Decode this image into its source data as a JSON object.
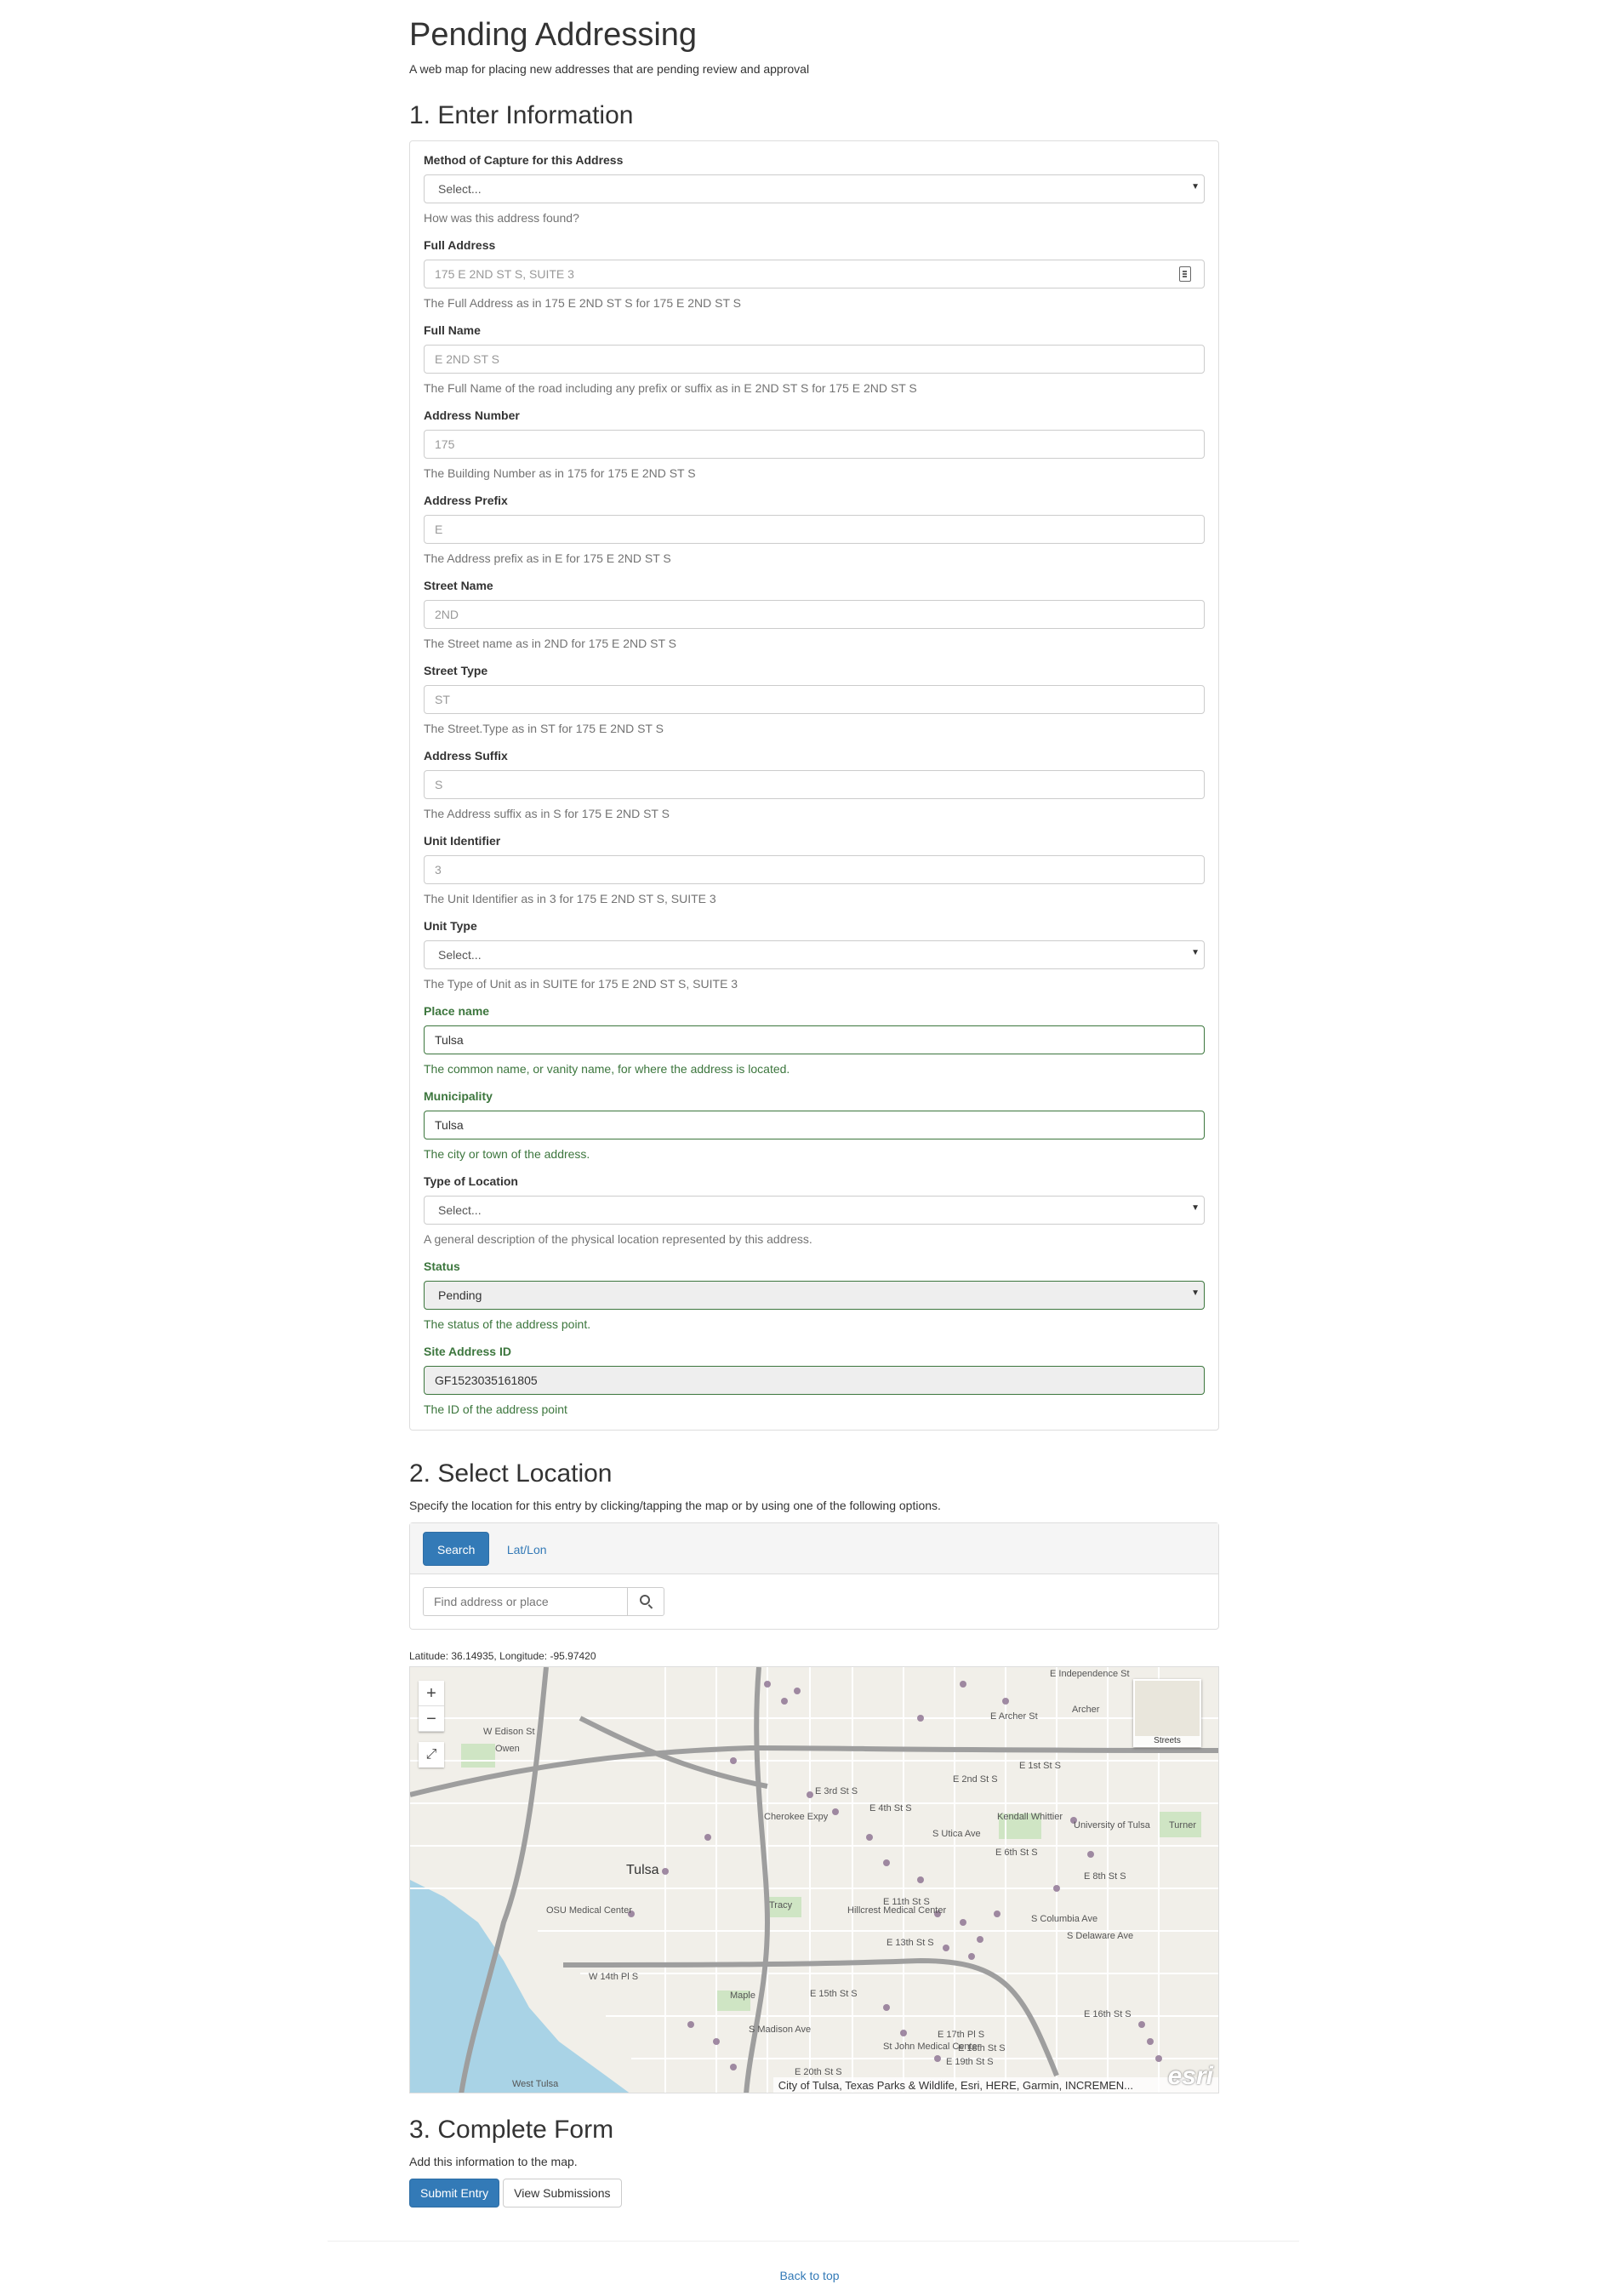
{
  "header": {
    "title": "Pending Addressing",
    "subtitle": "A web map for placing new addresses that are pending review and approval"
  },
  "section1": {
    "title": "1. Enter Information",
    "fields": [
      {
        "label": "Method of Capture for this Address",
        "type": "select",
        "value": "Select...",
        "help": "How was this address found?"
      },
      {
        "label": "Full Address",
        "type": "input",
        "placeholder": "175 E 2ND ST S, SUITE 3",
        "help": "The Full Address as in 175 E 2ND ST S for 175 E 2ND ST S"
      },
      {
        "label": "Full Name",
        "type": "input",
        "placeholder": "E 2ND ST S",
        "help": "The Full Name of the road including any prefix or suffix as in E 2ND ST S for 175 E 2ND ST S"
      },
      {
        "label": "Address Number",
        "type": "input",
        "placeholder": "175",
        "help": "The Building Number as in 175 for 175 E 2ND ST S"
      },
      {
        "label": "Address Prefix",
        "type": "input",
        "placeholder": "E",
        "help": "The Address prefix as in E for 175 E 2ND ST S"
      },
      {
        "label": "Street Name",
        "type": "input",
        "placeholder": "2ND",
        "help": "The Street name as in 2ND for 175 E 2ND ST S"
      },
      {
        "label": "Street Type",
        "type": "input",
        "placeholder": "ST",
        "help": "The Street.Type as in ST for 175 E 2ND ST S"
      },
      {
        "label": "Address Suffix",
        "type": "input",
        "placeholder": "S",
        "help": "The Address suffix as in S for 175 E 2ND ST S"
      },
      {
        "label": "Unit Identifier",
        "type": "input",
        "placeholder": "3",
        "help": "The Unit Identifier as in 3 for 175 E 2ND ST S, SUITE 3"
      },
      {
        "label": "Unit Type",
        "type": "select",
        "value": "Select...",
        "help": "The Type of Unit as in SUITE for 175 E 2ND ST S, SUITE 3"
      },
      {
        "label": "Place name",
        "type": "input",
        "value": "Tulsa",
        "help": "The common name, or vanity name, for where the address is located."
      },
      {
        "label": "Municipality",
        "type": "input",
        "value": "Tulsa",
        "help": "The city or town of the address."
      },
      {
        "label": "Type of Location",
        "type": "select",
        "value": "Select...",
        "help": "A general description of the physical location represented by this address."
      },
      {
        "label": "Status",
        "type": "select",
        "value": "Pending",
        "help": "The status of the address point."
      },
      {
        "label": "Site Address ID",
        "type": "input",
        "value": "GF1523035161805",
        "help": "The ID of the address point"
      }
    ]
  },
  "section2": {
    "title": "2. Select Location",
    "description": "Specify the location for this entry by clicking/tapping the map or by using one of the following options.",
    "tabs": [
      "Search",
      "Lat/Lon"
    ],
    "search_placeholder": "Find address or place",
    "coords": "Latitude: 36.14935,  Longitude: -95.97420",
    "map": {
      "zoom_in": "+",
      "zoom_out": "−",
      "fullscreen": "⤢",
      "basemap_label": "Streets",
      "attribution": "City of Tulsa, Texas Parks & Wildlife, Esri, HERE, Garmin, INCREMEN...",
      "logo": "esri",
      "labels": {
        "city": "Tulsa",
        "l1": "E Independence St",
        "l2": "E Archer St",
        "l3": "E 1st St S",
        "l4": "E 2nd St S",
        "l5": "W Edison St",
        "l6": "E 3rd St S",
        "l7": "E 4th St S",
        "l8": "E 6th St S",
        "l9": "E 8th St S",
        "l10": "E 11th St S",
        "l11": "E 13th St S",
        "l12": "E 15th St S",
        "l13": "E 16th St S",
        "l14": "E 17th Pl S",
        "l15": "E 18th St S",
        "l16": "E 19th St S",
        "l17": "E 20th St S",
        "l18": "W 14th Pl S",
        "l19": "Owen",
        "l20": "Kendall Whittier",
        "l21": "University of Tulsa",
        "l22": "Turner",
        "l23": "Tracy",
        "l24": "Maple",
        "l25": "West Tulsa",
        "l26": "OSU Medical Center",
        "l27": "Hillcrest Medical Center",
        "l28": "St John Medical Center",
        "l29": "Archer",
        "l30": "S Madison Ave",
        "l31": "S Columbia Ave",
        "l32": "S Delaware Ave",
        "l33": "S Utica Ave",
        "l34": "Cherokee Expy"
      }
    }
  },
  "section3": {
    "title": "3. Complete Form",
    "description": "Add this information to the map.",
    "submit_label": "Submit Entry",
    "view_label": "View Submissions"
  },
  "footer": {
    "back_to_top": "Back to top"
  },
  "colors": {
    "primary": "#337ab7",
    "success": "#3c763d",
    "address_points": "#8a6f8f",
    "water": "#a9d3e6"
  }
}
